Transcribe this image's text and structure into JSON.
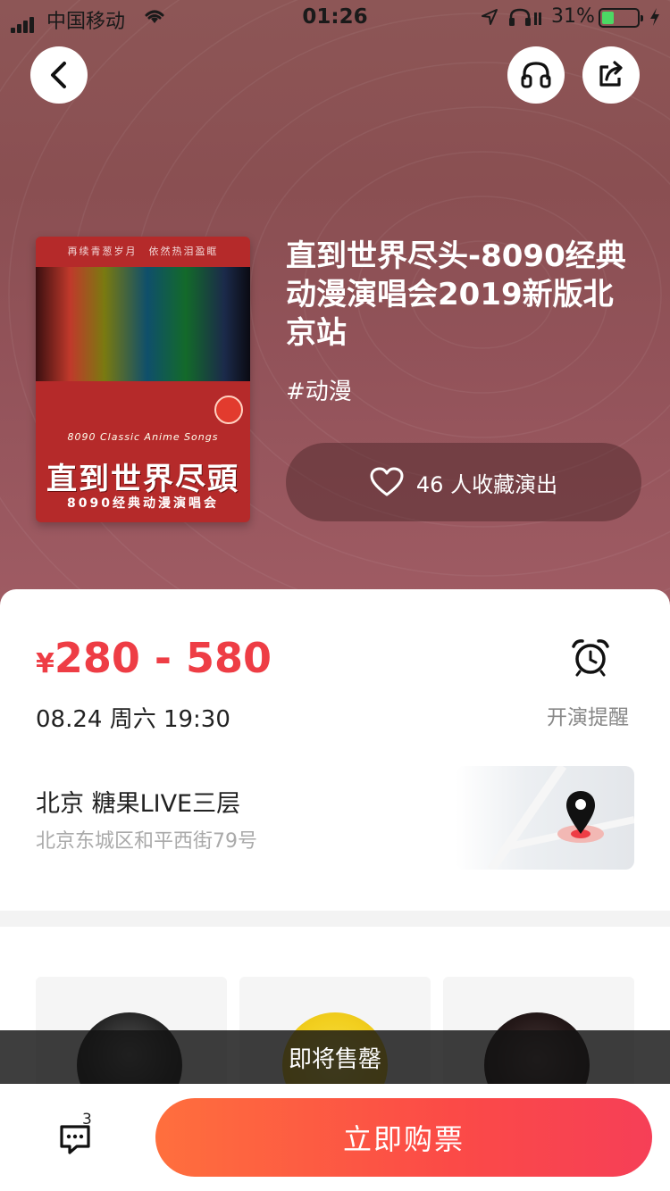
{
  "status_bar": {
    "carrier": "中国移动",
    "time": "01:26",
    "battery_percent": "31%"
  },
  "header": {
    "back_icon": "chevron-left-icon",
    "audio_icon": "headphones-icon",
    "share_icon": "share-icon"
  },
  "poster": {
    "top_text": "再续青葱岁月　依然热泪盈眶",
    "subtitle": "8090 Classic Anime Songs",
    "title": "直到世界尽頭",
    "title2": "8090经典动漫演唱会"
  },
  "show": {
    "title": "直到世界尽头-8090经典动漫演唱会2019新版北京站",
    "tag": "#动漫",
    "favorite_label": "46 人收藏演出"
  },
  "details": {
    "price_currency": "¥",
    "price_range": "280 - 580",
    "datetime": "08.24 周六 19:30",
    "reminder_label": "开演提醒",
    "venue_name": "北京 糖果LIVE三层",
    "venue_address": "北京东城区和平西街79号"
  },
  "related": {
    "toast": "即将售罄"
  },
  "bottom_bar": {
    "chat_badge": "3",
    "buy_label": "立即购票"
  },
  "colors": {
    "accent": "#ee3d45",
    "buy_gradient_start": "#ff6f3d",
    "buy_gradient_end": "#f63f57",
    "hero_bg": "#8d5656"
  }
}
